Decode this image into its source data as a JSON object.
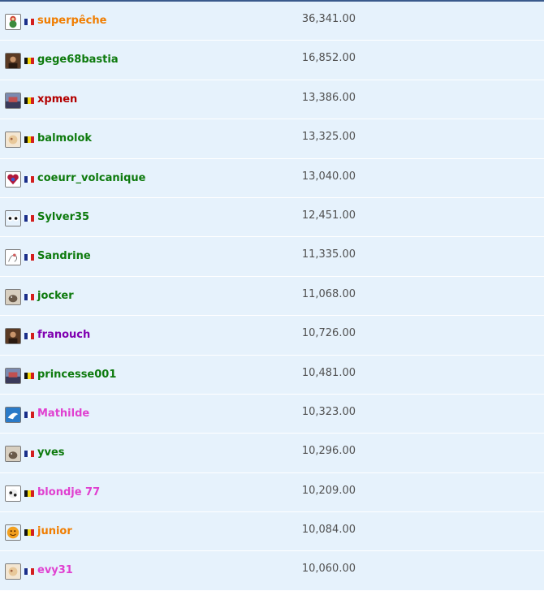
{
  "flags": {
    "fr": [
      "#1a2f8a",
      "#ffffff",
      "#d21f1f"
    ],
    "be": [
      "#111111",
      "#f5d90a",
      "#d21f1f"
    ]
  },
  "rows": [
    {
      "name": "superpêche",
      "score": "36,341.00",
      "color": "#f07d00",
      "flag": "fr",
      "avatar_icon": "snowman-avatar-icon"
    },
    {
      "name": "gege68bastia",
      "score": "16,852.00",
      "color": "#0d7a0d",
      "flag": "be",
      "avatar_icon": "portrait-avatar-icon"
    },
    {
      "name": "xpmen",
      "score": "13,386.00",
      "color": "#b30000",
      "flag": "be",
      "avatar_icon": "scene-avatar-icon"
    },
    {
      "name": "balmolok",
      "score": "13,325.00",
      "color": "#0d7a0d",
      "flag": "be",
      "avatar_icon": "picture-avatar-icon"
    },
    {
      "name": "coeurr_volcanique",
      "score": "13,040.00",
      "color": "#0d7a0d",
      "flag": "fr",
      "avatar_icon": "heart-avatar-icon"
    },
    {
      "name": "Sylver35",
      "score": "12,451.00",
      "color": "#0d7a0d",
      "flag": "fr",
      "avatar_icon": "eyes-avatar-icon"
    },
    {
      "name": "Sandrine",
      "score": "11,335.00",
      "color": "#0d7a0d",
      "flag": "fr",
      "avatar_icon": "sketch-avatar-icon"
    },
    {
      "name": "jocker",
      "score": "11,068.00",
      "color": "#0d7a0d",
      "flag": "fr",
      "avatar_icon": "animal-avatar-icon"
    },
    {
      "name": "franouch",
      "score": "10,726.00",
      "color": "#8000b0",
      "flag": "fr",
      "avatar_icon": "portrait-avatar-icon"
    },
    {
      "name": "princesse001",
      "score": "10,481.00",
      "color": "#0d7a0d",
      "flag": "be",
      "avatar_icon": "scene-avatar-icon"
    },
    {
      "name": "Mathilde",
      "score": "10,323.00",
      "color": "#e040d0",
      "flag": "fr",
      "avatar_icon": "bird-avatar-icon"
    },
    {
      "name": "yves",
      "score": "10,296.00",
      "color": "#0d7a0d",
      "flag": "fr",
      "avatar_icon": "animal-avatar-icon"
    },
    {
      "name": "blondje 77",
      "score": "10,209.00",
      "color": "#e040d0",
      "flag": "be",
      "avatar_icon": "dog-avatar-icon"
    },
    {
      "name": "junior",
      "score": "10,084.00",
      "color": "#f07d00",
      "flag": "be",
      "avatar_icon": "smiley-avatar-icon"
    },
    {
      "name": "evy31",
      "score": "10,060.00",
      "color": "#e040d0",
      "flag": "fr",
      "avatar_icon": "picture-avatar-icon"
    }
  ]
}
